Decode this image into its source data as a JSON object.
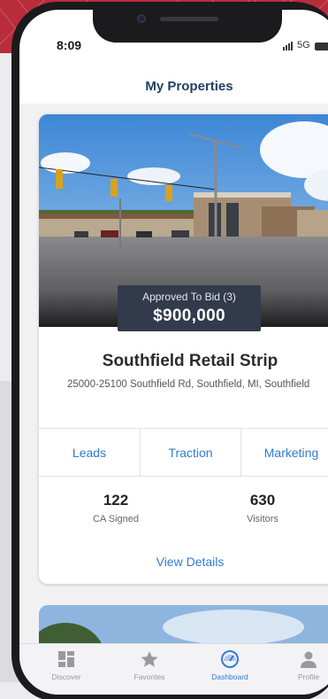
{
  "status_bar": {
    "time": "8:09",
    "network": "5G"
  },
  "header": {
    "title": "My Properties"
  },
  "property": {
    "status": "Approved To Bid (3)",
    "price": "$900,000",
    "name": "Southfield Retail Strip",
    "address": "25000-25100 Southfield Rd, Southfield, MI, Southfield",
    "tabs": [
      {
        "label": "Leads"
      },
      {
        "label": "Traction"
      },
      {
        "label": "Marketing"
      }
    ],
    "stats": [
      {
        "value": "122",
        "label": "CA Signed"
      },
      {
        "value": "630",
        "label": "Visitors"
      }
    ],
    "view_details": "View Details"
  },
  "tab_bar": {
    "items": [
      {
        "label": "Discover",
        "icon": "grid-icon"
      },
      {
        "label": "Favorites",
        "icon": "star-icon"
      },
      {
        "label": "Dashboard",
        "icon": "gauge-icon",
        "active": true
      },
      {
        "label": "Profile",
        "icon": "person-icon"
      }
    ]
  },
  "colors": {
    "accent": "#2f7bd3",
    "title": "#1f3f66",
    "badge": "#323a4c"
  }
}
